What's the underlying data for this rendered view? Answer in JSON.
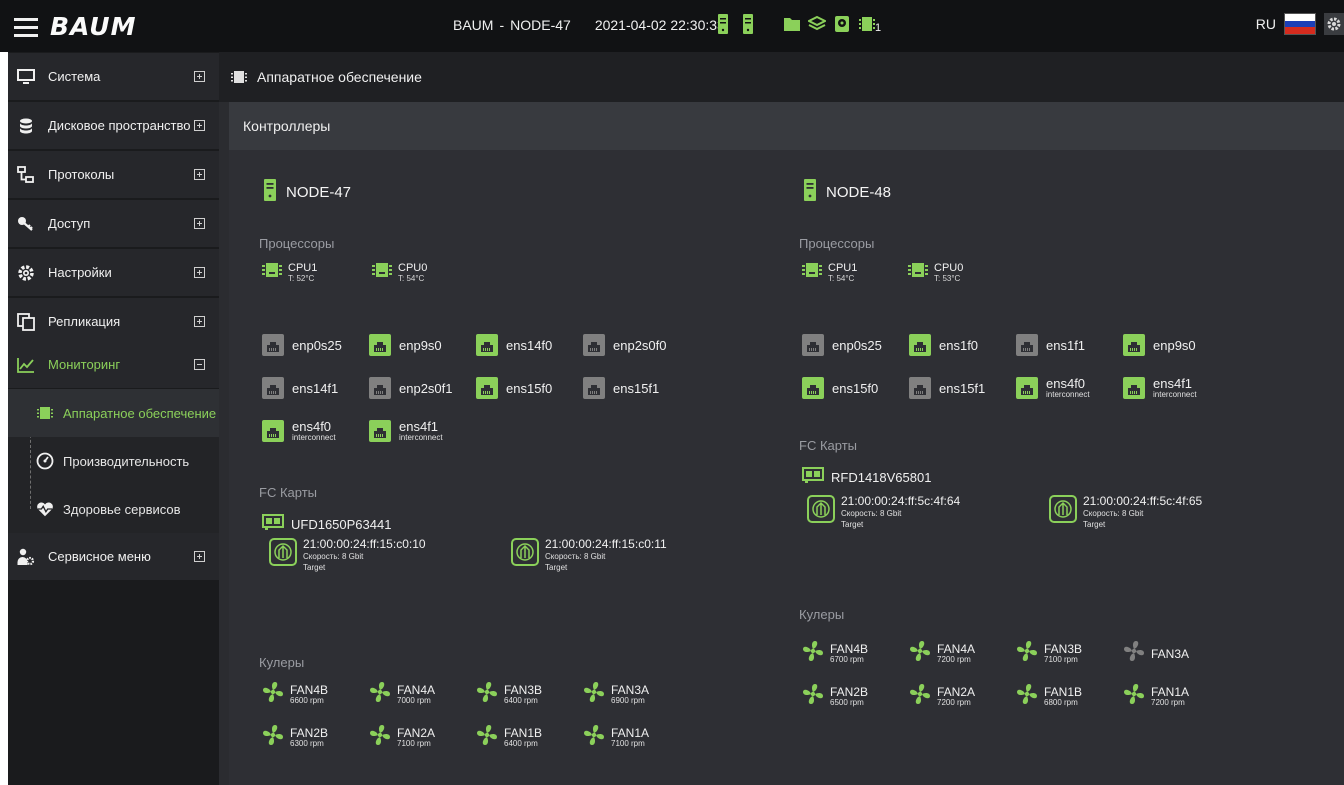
{
  "header": {
    "logo": "BAUM",
    "system": "BAUM",
    "sep": "-",
    "node": "NODE-47",
    "datetime": "2021-04-02 22:30:33",
    "badge_count": "1",
    "lang": "RU"
  },
  "colors": {
    "accent": "#8bd05a",
    "inactive": "#808080"
  },
  "sidebar": {
    "items": [
      {
        "label": "Система",
        "icon": "monitor-icon"
      },
      {
        "label": "Дисковое пространство",
        "icon": "database-icon"
      },
      {
        "label": "Протоколы",
        "icon": "network-icon"
      },
      {
        "label": "Доступ",
        "icon": "key-icon"
      },
      {
        "label": "Настройки",
        "icon": "gear-icon"
      },
      {
        "label": "Репликация",
        "icon": "copy-icon"
      },
      {
        "label": "Мониторинг",
        "icon": "chart-icon"
      },
      {
        "label": "Сервисное меню",
        "icon": "user-gear-icon"
      }
    ],
    "monitoring_sub": [
      {
        "label": "Аппаратное обеспечение",
        "icon": "chip-icon"
      },
      {
        "label": "Производительность",
        "icon": "gauge-icon"
      },
      {
        "label": "Здоровье сервисов",
        "icon": "heart-pulse-icon"
      }
    ]
  },
  "breadcrumb": "Аппаратное обеспечение",
  "panel_title": "Контроллеры",
  "labels": {
    "cpus": "Процессоры",
    "fc": "FC Карты",
    "fans": "Кулеры"
  },
  "nodes": [
    {
      "name": "NODE-47",
      "cpus": [
        {
          "name": "CPU1",
          "temp": "T: 52°C"
        },
        {
          "name": "CPU0",
          "temp": "T: 54°C"
        }
      ],
      "ports": [
        {
          "name": "enp0s25",
          "sub": "",
          "active": false
        },
        {
          "name": "enp9s0",
          "sub": "",
          "active": true
        },
        {
          "name": "ens14f0",
          "sub": "",
          "active": true
        },
        {
          "name": "enp2s0f0",
          "sub": "",
          "active": false
        },
        {
          "name": "ens14f1",
          "sub": "",
          "active": false
        },
        {
          "name": "enp2s0f1",
          "sub": "",
          "active": false
        },
        {
          "name": "ens15f0",
          "sub": "",
          "active": true
        },
        {
          "name": "ens15f1",
          "sub": "",
          "active": false
        },
        {
          "name": "ens4f0",
          "sub": "interconnect",
          "active": true
        },
        {
          "name": "ens4f1",
          "sub": "interconnect",
          "active": true
        }
      ],
      "fc_card": "UFD1650P63441",
      "wwns": [
        {
          "wwn": "21:00:00:24:ff:15:c0:10",
          "speed": "Скорость: 8 Gbit",
          "role": "Target"
        },
        {
          "wwn": "21:00:00:24:ff:15:c0:11",
          "speed": "Скорость: 8 Gbit",
          "role": "Target"
        }
      ],
      "fans": [
        {
          "name": "FAN4B",
          "rpm": "6600 rpm",
          "active": true
        },
        {
          "name": "FAN4A",
          "rpm": "7000 rpm",
          "active": true
        },
        {
          "name": "FAN3B",
          "rpm": "6400 rpm",
          "active": true
        },
        {
          "name": "FAN3A",
          "rpm": "6900 rpm",
          "active": true
        },
        {
          "name": "FAN2B",
          "rpm": "6300 rpm",
          "active": true
        },
        {
          "name": "FAN2A",
          "rpm": "7100 rpm",
          "active": true
        },
        {
          "name": "FAN1B",
          "rpm": "6400 rpm",
          "active": true
        },
        {
          "name": "FAN1A",
          "rpm": "7100 rpm",
          "active": true
        }
      ]
    },
    {
      "name": "NODE-48",
      "cpus": [
        {
          "name": "CPU1",
          "temp": "T: 54°C"
        },
        {
          "name": "CPU0",
          "temp": "T: 53°C"
        }
      ],
      "ports": [
        {
          "name": "enp0s25",
          "sub": "",
          "active": false
        },
        {
          "name": "ens1f0",
          "sub": "",
          "active": true
        },
        {
          "name": "ens1f1",
          "sub": "",
          "active": false
        },
        {
          "name": "enp9s0",
          "sub": "",
          "active": true
        },
        {
          "name": "ens15f0",
          "sub": "",
          "active": true
        },
        {
          "name": "ens15f1",
          "sub": "",
          "active": false
        },
        {
          "name": "ens4f0",
          "sub": "interconnect",
          "active": true
        },
        {
          "name": "ens4f1",
          "sub": "interconnect",
          "active": true
        }
      ],
      "fc_card": "RFD1418V65801",
      "wwns": [
        {
          "wwn": "21:00:00:24:ff:5c:4f:64",
          "speed": "Скорость: 8 Gbit",
          "role": "Target"
        },
        {
          "wwn": "21:00:00:24:ff:5c:4f:65",
          "speed": "Скорость: 8 Gbit",
          "role": "Target"
        }
      ],
      "fans": [
        {
          "name": "FAN4B",
          "rpm": "6700 rpm",
          "active": true
        },
        {
          "name": "FAN4A",
          "rpm": "7200 rpm",
          "active": true
        },
        {
          "name": "FAN3B",
          "rpm": "7100 rpm",
          "active": true
        },
        {
          "name": "FAN3A",
          "rpm": "",
          "active": false
        },
        {
          "name": "FAN2B",
          "rpm": "6500 rpm",
          "active": true
        },
        {
          "name": "FAN2A",
          "rpm": "7200 rpm",
          "active": true
        },
        {
          "name": "FAN1B",
          "rpm": "6800 rpm",
          "active": true
        },
        {
          "name": "FAN1A",
          "rpm": "7200 rpm",
          "active": true
        }
      ]
    }
  ]
}
